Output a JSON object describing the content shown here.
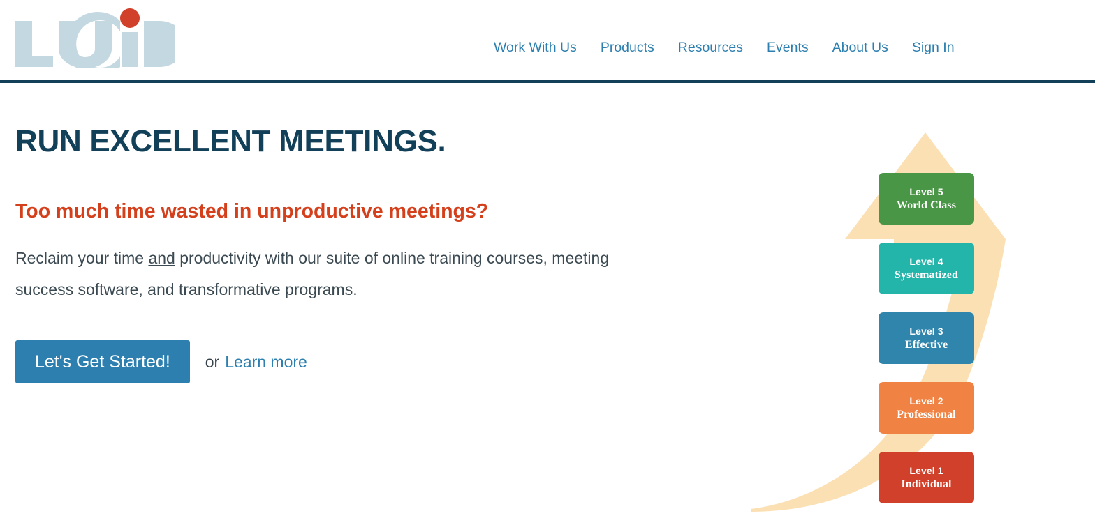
{
  "brand": {
    "logo_text": "LUCID",
    "logo_color": "#C4D8E2",
    "logo_dot_color": "#D0402A"
  },
  "header": {
    "nav": [
      {
        "label": "Work With Us",
        "name": "nav-work-with-us"
      },
      {
        "label": "Products",
        "name": "nav-products"
      },
      {
        "label": "Resources",
        "name": "nav-resources"
      },
      {
        "label": "Events",
        "name": "nav-events"
      },
      {
        "label": "About Us",
        "name": "nav-about-us"
      },
      {
        "label": "Sign In",
        "name": "nav-sign-in"
      }
    ],
    "nav_color": "#2C7FAF",
    "rule_color": "#124059"
  },
  "hero": {
    "headline": "RUN EXCELLENT MEETINGS.",
    "headline_color": "#124059",
    "subheadline": "Too much time wasted in unproductive meetings?",
    "subheadline_color": "#D4401C",
    "body_part1": "Reclaim your time ",
    "body_emphasis": "and",
    "body_part2": " productivity with our suite of online training courses, meeting success software, and transformative programs.",
    "cta_button_label": "Let's Get Started!",
    "cta_button_color": "#2C7FAF",
    "cta_or_label": "or",
    "cta_link_label": "Learn more",
    "cta_link_color": "#2C7FAF"
  },
  "graphic": {
    "arrow_color": "#FBE0B4",
    "levels": [
      {
        "num": "Level 5",
        "label": "World Class",
        "color": "#4A9647",
        "name": "level-5-world-class"
      },
      {
        "num": "Level 4",
        "label": "Systematized",
        "color": "#23B4AA",
        "name": "level-4-systematized"
      },
      {
        "num": "Level 3",
        "label": "Effective",
        "color": "#2F85AB",
        "name": "level-3-effective"
      },
      {
        "num": "Level 2",
        "label": "Professional",
        "color": "#F08343",
        "name": "level-2-professional"
      },
      {
        "num": "Level 1",
        "label": "Individual",
        "color": "#D0402A",
        "name": "level-1-individual"
      }
    ]
  }
}
